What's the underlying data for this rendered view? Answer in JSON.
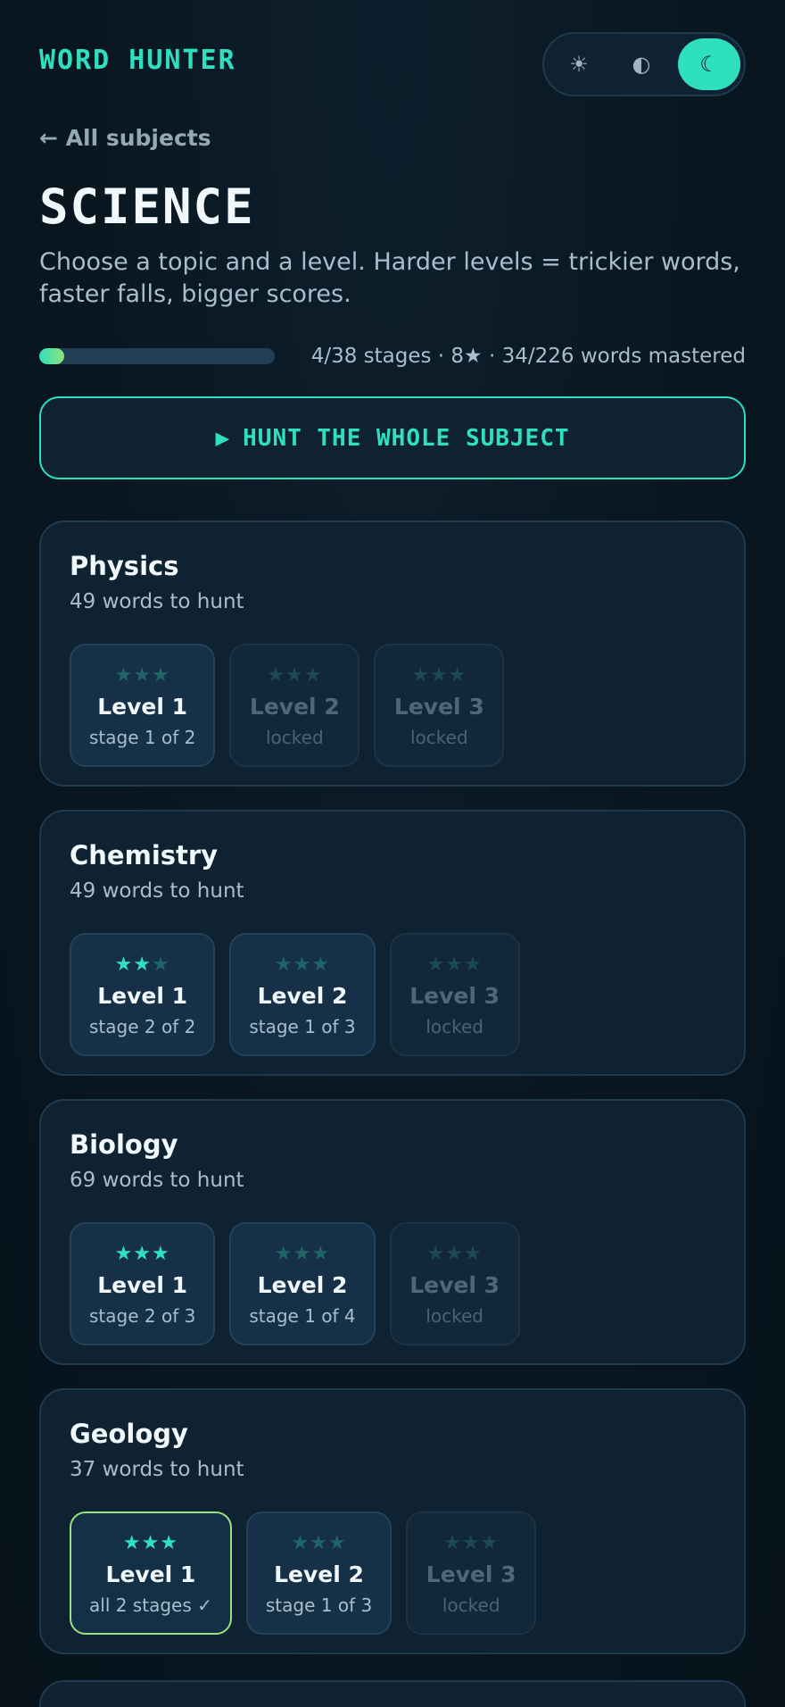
{
  "header": {
    "brand": "WORD HUNTER",
    "theme": [
      {
        "icon": "sun-icon",
        "glyph": "☀",
        "active": false
      },
      {
        "icon": "contrast-icon",
        "glyph": "◐",
        "active": false
      },
      {
        "icon": "moon-icon",
        "glyph": "☾",
        "active": true
      }
    ]
  },
  "nav": {
    "back_label": "← All subjects"
  },
  "page": {
    "title": "SCIENCE",
    "subtitle": "Choose a topic and a level. Harder levels = trickier words, faster falls, bigger scores."
  },
  "progress": {
    "fraction": 0.105,
    "text": "4/38 stages · 8★ · 34/226 words mastered"
  },
  "hunt_button": {
    "icon": "play-icon",
    "glyph": "▶",
    "label": "HUNT THE WHOLE SUBJECT"
  },
  "topics": [
    {
      "name": "Physics",
      "count": "49 words to hunt",
      "levels": [
        {
          "title": "Level 1",
          "sub": "stage 1 of 2",
          "stars": 0,
          "state": "open"
        },
        {
          "title": "Level 2",
          "sub": "locked",
          "stars": 0,
          "state": "locked"
        },
        {
          "title": "Level 3",
          "sub": "locked",
          "stars": 0,
          "state": "locked"
        }
      ]
    },
    {
      "name": "Chemistry",
      "count": "49 words to hunt",
      "levels": [
        {
          "title": "Level 1",
          "sub": "stage 2 of 2",
          "stars": 2,
          "state": "open"
        },
        {
          "title": "Level 2",
          "sub": "stage 1 of 3",
          "stars": 0,
          "state": "open"
        },
        {
          "title": "Level 3",
          "sub": "locked",
          "stars": 0,
          "state": "locked"
        }
      ]
    },
    {
      "name": "Biology",
      "count": "69 words to hunt",
      "levels": [
        {
          "title": "Level 1",
          "sub": "stage 2 of 3",
          "stars": 3,
          "state": "open"
        },
        {
          "title": "Level 2",
          "sub": "stage 1 of 4",
          "stars": 0,
          "state": "open"
        },
        {
          "title": "Level 3",
          "sub": "locked",
          "stars": 0,
          "state": "locked"
        }
      ]
    },
    {
      "name": "Geology",
      "count": "37 words to hunt",
      "levels": [
        {
          "title": "Level 1",
          "sub": "all 2 stages ✓",
          "stars": 3,
          "state": "complete"
        },
        {
          "title": "Level 2",
          "sub": "stage 1 of 3",
          "stars": 0,
          "state": "open"
        },
        {
          "title": "Level 3",
          "sub": "locked",
          "stars": 0,
          "state": "locked"
        }
      ]
    }
  ],
  "colors": {
    "accent": "#2ee0c0",
    "complete_border": "#9be37c",
    "background": "#0b1a25",
    "card": "#0f2231"
  }
}
